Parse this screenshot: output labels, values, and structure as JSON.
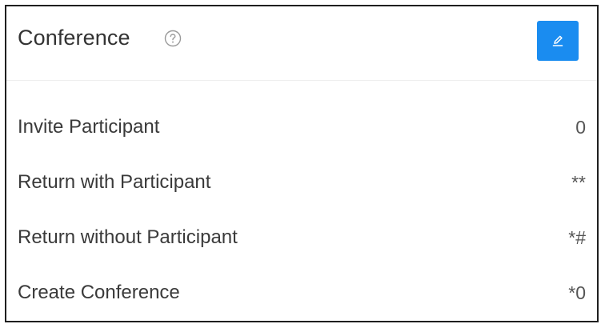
{
  "panel": {
    "title": "Conference",
    "help_icon": "question-circle-icon",
    "edit_icon": "pencil-icon",
    "accent_color": "#1a8cf0"
  },
  "rows": [
    {
      "label": "Invite Participant",
      "value": "0"
    },
    {
      "label": "Return with Participant",
      "value": "**"
    },
    {
      "label": "Return without Participant",
      "value": "*#"
    },
    {
      "label": "Create Conference",
      "value": "*0"
    }
  ]
}
